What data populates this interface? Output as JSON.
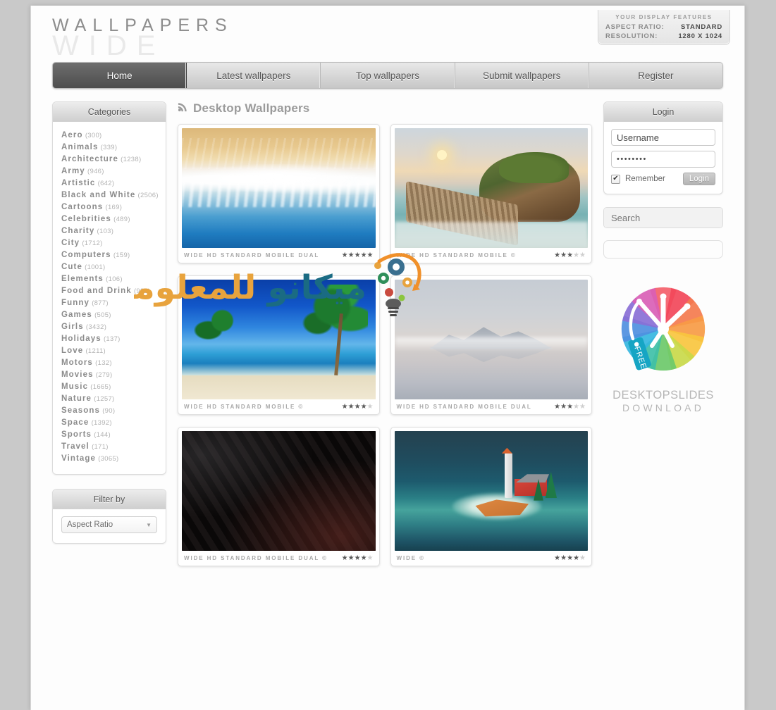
{
  "site": {
    "logo_line1": "WALLPAPERS",
    "logo_line2": "WIDE"
  },
  "display_features": {
    "title": "YOUR DISPLAY FEATURES",
    "aspect_label": "ASPECT RATIO:",
    "aspect_value": "STANDARD",
    "resolution_label": "RESOLUTION:",
    "resolution_value": "1280 X 1024"
  },
  "nav": {
    "items": [
      {
        "label": "Home",
        "active": true
      },
      {
        "label": "Latest wallpapers",
        "active": false
      },
      {
        "label": "Top wallpapers",
        "active": false
      },
      {
        "label": "Submit wallpapers",
        "active": false
      },
      {
        "label": "Register",
        "active": false
      }
    ]
  },
  "sidebar": {
    "categories_title": "Categories",
    "categories": [
      {
        "name": "Aero",
        "count": "(300)"
      },
      {
        "name": "Animals",
        "count": "(339)"
      },
      {
        "name": "Architecture",
        "count": "(1238)"
      },
      {
        "name": "Army",
        "count": "(946)"
      },
      {
        "name": "Artistic",
        "count": "(642)"
      },
      {
        "name": "Black and White",
        "count": "(2506)"
      },
      {
        "name": "Cartoons",
        "count": "(169)"
      },
      {
        "name": "Celebrities",
        "count": "(489)"
      },
      {
        "name": "Charity",
        "count": "(103)"
      },
      {
        "name": "City",
        "count": "(1712)"
      },
      {
        "name": "Computers",
        "count": "(159)"
      },
      {
        "name": "Cute",
        "count": "(1001)"
      },
      {
        "name": "Elements",
        "count": "(106)"
      },
      {
        "name": "Food and Drink",
        "count": "(992)"
      },
      {
        "name": "Funny",
        "count": "(877)"
      },
      {
        "name": "Games",
        "count": "(505)"
      },
      {
        "name": "Girls",
        "count": "(3432)"
      },
      {
        "name": "Holidays",
        "count": "(137)"
      },
      {
        "name": "Love",
        "count": "(1211)"
      },
      {
        "name": "Motors",
        "count": "(132)"
      },
      {
        "name": "Movies",
        "count": "(279)"
      },
      {
        "name": "Music",
        "count": "(1665)"
      },
      {
        "name": "Nature",
        "count": "(1257)"
      },
      {
        "name": "Seasons",
        "count": "(90)"
      },
      {
        "name": "Space",
        "count": "(1392)"
      },
      {
        "name": "Sports",
        "count": "(144)"
      },
      {
        "name": "Travel",
        "count": "(171)"
      },
      {
        "name": "Vintage",
        "count": "(3065)"
      }
    ],
    "filter_title": "Filter by",
    "filter_select_value": "Aspect Ratio"
  },
  "main": {
    "heading": "Desktop Wallpapers",
    "rss_icon": "rss-icon",
    "wallpapers": [
      {
        "subject": "aerial ocean waves on golden sand beach",
        "tags": "WIDE HD STANDARD MOBILE DUAL",
        "copyright": "",
        "rating": 4.5
      },
      {
        "subject": "rocky island with stone bridge at sunset",
        "tags": "WIDE HD STANDARD MOBILE",
        "copyright": "©",
        "rating": 3
      },
      {
        "subject": "tropical beach with palm trees and blue sky",
        "tags": "WIDE HD STANDARD MOBILE",
        "copyright": "©",
        "rating": 3.5
      },
      {
        "subject": "misty snowy mountain reflected in still lake",
        "tags": "WIDE HD STANDARD MOBILE DUAL",
        "copyright": "",
        "rating": 3
      },
      {
        "subject": "dark black geometric triangular texture",
        "tags": "WIDE HD STANDARD MOBILE DUAL",
        "copyright": "©",
        "rating": 3.5
      },
      {
        "subject": "low poly lighthouse island with red cabin",
        "tags": "WIDE",
        "copyright": "©",
        "rating": 3.5
      }
    ]
  },
  "login": {
    "title": "Login",
    "username_value": "Username",
    "username_placeholder": "Username",
    "password_value": "••••••••",
    "remember_label": "Remember",
    "remember_checked": true,
    "button_label": "Login"
  },
  "search": {
    "placeholder": "Search",
    "value": "",
    "icon": "magnifier-icon"
  },
  "ad": {
    "logo": "colorful-pinwheel-logo",
    "tag_label": "FREE",
    "title_line1": "DESKTOPSLIDES",
    "title_line2": "DOWNLOAD"
  },
  "watermark": {
    "text": "ميكانو للمعلوميات",
    "color_orange": "#e8a33d",
    "color_teal": "#1a6b83",
    "icon": "gears-lightbulb-logo"
  },
  "colors": {
    "page_bg": "#c9c9c9",
    "panel_bg": "#ffffff",
    "nav_active": "#5a5a5a",
    "text_muted": "#8b8b8b"
  }
}
